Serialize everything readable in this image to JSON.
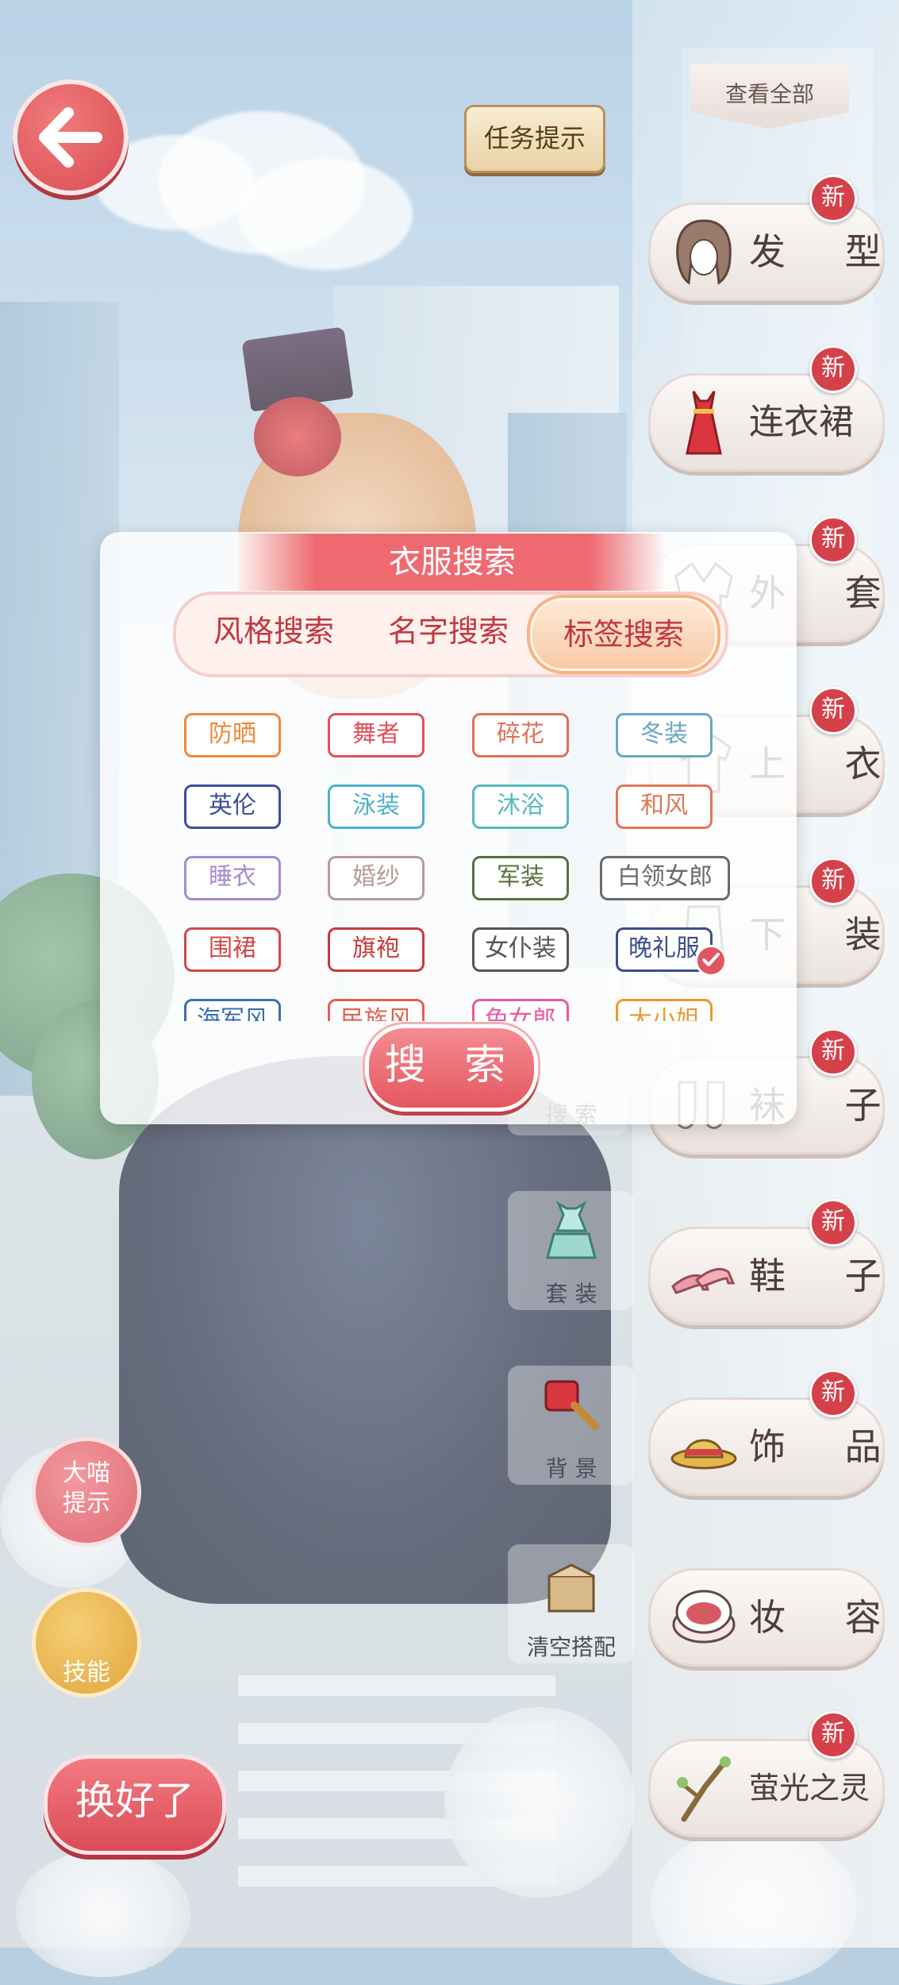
{
  "top": {
    "back_icon": "arrow-left-icon",
    "hint_label": "任务提示",
    "view_all_label": "查看全部"
  },
  "categories": [
    {
      "label": "发 型",
      "icon": "hair-icon",
      "badge": "新"
    },
    {
      "label": "连衣裙",
      "icon": "dress-icon",
      "badge": "新"
    },
    {
      "label": "外 套",
      "icon": "coat-icon",
      "badge": "新"
    },
    {
      "label": "上 衣",
      "icon": "top-icon",
      "badge": "新"
    },
    {
      "label": "下 装",
      "icon": "bottom-icon",
      "badge": "新"
    },
    {
      "label": "袜 子",
      "icon": "socks-icon",
      "badge": "新"
    },
    {
      "label": "鞋 子",
      "icon": "shoes-icon",
      "badge": "新"
    },
    {
      "label": "饰 品",
      "icon": "hat-icon",
      "badge": "新"
    },
    {
      "label": "妆 容",
      "icon": "makeup-icon",
      "badge": ""
    },
    {
      "label": "萤光之灵",
      "icon": "branch-icon",
      "badge": "新"
    }
  ],
  "tools": {
    "search_label": "搜 索",
    "suit_label": "套 装",
    "background_label": "背 景",
    "clear_label": "清空搭配"
  },
  "left_buttons": {
    "cat_hint": "大喵\n提示",
    "skill": "技能",
    "done": "换好了"
  },
  "dialog": {
    "title": "衣服搜索",
    "tabs": [
      "风格搜索",
      "名字搜索",
      "标签搜索"
    ],
    "active_tab": "标签搜索",
    "tags": [
      {
        "label": "防晒",
        "color": "#f0883a"
      },
      {
        "label": "舞者",
        "color": "#e0505a"
      },
      {
        "label": "碎花",
        "color": "#e07058"
      },
      {
        "label": "冬装",
        "color": "#6aa7c0"
      },
      {
        "label": "英伦",
        "color": "#3b4f9a"
      },
      {
        "label": "泳装",
        "color": "#4fb0c8"
      },
      {
        "label": "沐浴",
        "color": "#58b8c0"
      },
      {
        "label": "和风",
        "color": "#e07858"
      },
      {
        "label": "睡衣",
        "color": "#a88ad0"
      },
      {
        "label": "婚纱",
        "color": "#b89a9a"
      },
      {
        "label": "军装",
        "color": "#5a7040"
      },
      {
        "label": "白领女郎",
        "color": "#6a6a6a"
      },
      {
        "label": "围裙",
        "color": "#d0484a"
      },
      {
        "label": "旗袍",
        "color": "#c83a3a"
      },
      {
        "label": "女仆装",
        "color": "#555555"
      },
      {
        "label": "晚礼服",
        "color": "#3b4f8a",
        "selected": true
      },
      {
        "label": "海军风",
        "color": "#3b6fb0"
      },
      {
        "label": "民族风",
        "color": "#e06050"
      },
      {
        "label": "兔女郎",
        "color": "#e85aa0"
      },
      {
        "label": "大小姐",
        "color": "#e89a30"
      }
    ],
    "search_button": "搜 索"
  }
}
